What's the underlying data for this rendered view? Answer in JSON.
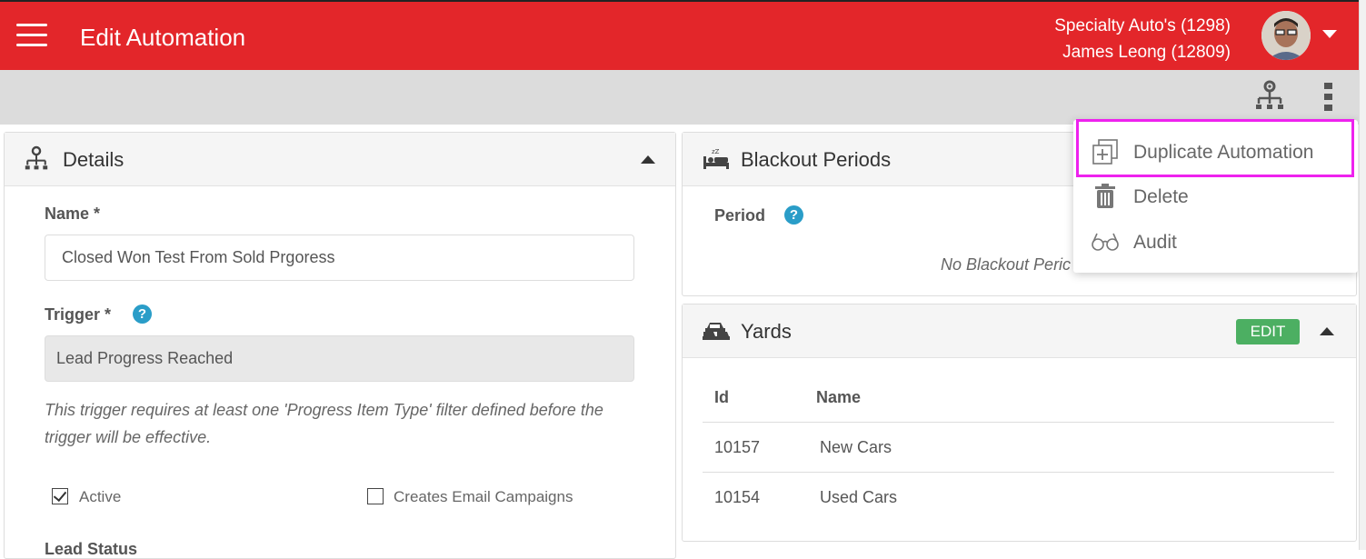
{
  "header": {
    "title": "Edit Automation",
    "account_line1": "Specialty Auto's (1298)",
    "account_line2": "James Leong (12809)",
    "bg_color": "#e3262a"
  },
  "details": {
    "title": "Details",
    "name_label": "Name *",
    "name_value": "Closed Won Test From Sold Prgoress",
    "trigger_label": "Trigger *",
    "trigger_value": "Lead Progress Reached",
    "trigger_hint": "This trigger requires at least one 'Progress Item Type' filter defined before the trigger will be effective.",
    "active_label": "Active",
    "active_checked": true,
    "creates_email_label": "Creates Email Campaigns",
    "creates_email_checked": false,
    "lead_status_label": "Lead Status"
  },
  "blackout": {
    "title": "Blackout Periods",
    "period_label": "Period",
    "empty_text": "No Blackout Peric"
  },
  "yards": {
    "title": "Yards",
    "edit_label": "EDIT",
    "columns": [
      "Id",
      "Name"
    ],
    "rows": [
      {
        "id": "10157",
        "name": "New Cars"
      },
      {
        "id": "10154",
        "name": "Used Cars"
      }
    ]
  },
  "menu": {
    "items": [
      {
        "label": "Duplicate Automation",
        "icon": "duplicate-icon"
      },
      {
        "label": "Delete",
        "icon": "trash-icon"
      },
      {
        "label": "Audit",
        "icon": "glasses-icon"
      }
    ],
    "highlight_color": "#ee22ee"
  }
}
